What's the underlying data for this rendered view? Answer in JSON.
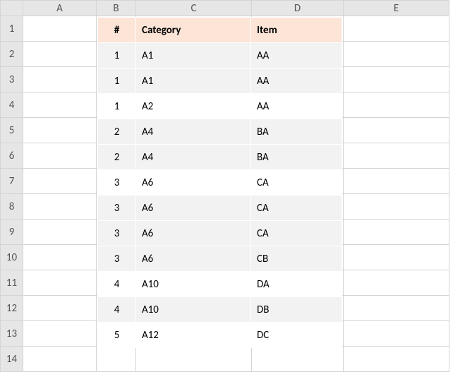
{
  "columns": [
    "A",
    "B",
    "C",
    "D",
    "E"
  ],
  "rows": [
    "1",
    "2",
    "3",
    "4",
    "5",
    "6",
    "7",
    "8",
    "9",
    "10",
    "11",
    "12",
    "13",
    "14"
  ],
  "table": {
    "headers": {
      "num": "#",
      "category": "Category",
      "item": "Item"
    },
    "rows": [
      {
        "num": "1",
        "category": "A1",
        "item": "AA"
      },
      {
        "num": "1",
        "category": "A1",
        "item": "AA"
      },
      {
        "num": "1",
        "category": "A2",
        "item": "AA"
      },
      {
        "num": "2",
        "category": "A4",
        "item": "BA"
      },
      {
        "num": "2",
        "category": "A4",
        "item": "BA"
      },
      {
        "num": "3",
        "category": "A6",
        "item": "CA"
      },
      {
        "num": "3",
        "category": "A6",
        "item": "CA"
      },
      {
        "num": "3",
        "category": "A6",
        "item": "CA"
      },
      {
        "num": "3",
        "category": "A6",
        "item": "CB"
      },
      {
        "num": "4",
        "category": "A10",
        "item": "DA"
      },
      {
        "num": "4",
        "category": "A10",
        "item": "DB"
      },
      {
        "num": "5",
        "category": "A12",
        "item": "DC"
      }
    ]
  }
}
